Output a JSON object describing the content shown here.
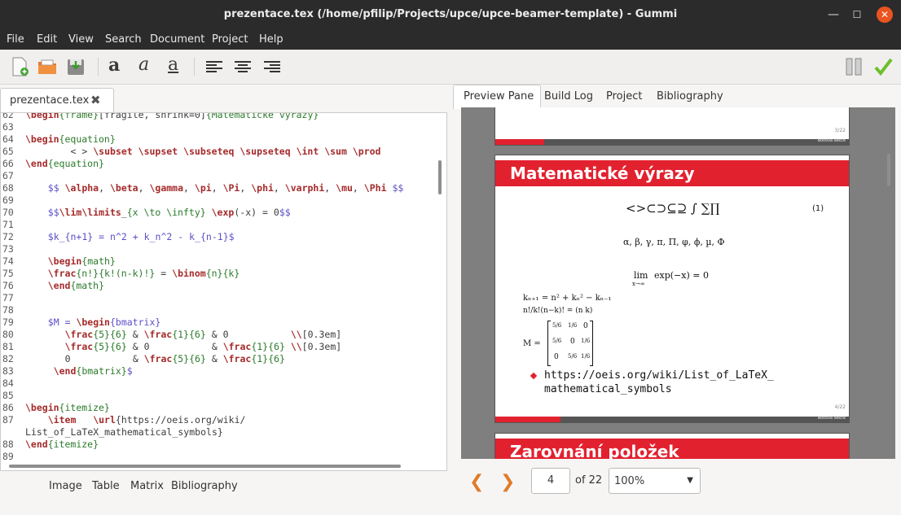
{
  "window": {
    "title": "prezentace.tex (/home/pfilip/Projects/upce/upce-beamer-template) - Gummi",
    "minimize": "—",
    "maximize": "☐",
    "close": "✕"
  },
  "menu": [
    "File",
    "Edit",
    "View",
    "Search",
    "Document",
    "Project",
    "Help"
  ],
  "toolbar": {
    "icons": [
      "new-document-icon",
      "open-folder-icon",
      "save-icon",
      "bold-icon",
      "italic-icon",
      "underline-icon",
      "align-left-icon",
      "align-center-icon",
      "align-right-icon",
      "preview-columns-icon",
      "compile-ok-icon"
    ],
    "bold_glyph": "a",
    "italic_glyph": "a",
    "underline_glyph": "a"
  },
  "editor": {
    "tab_label": "prezentace.tex",
    "tab_close": "✖",
    "lines": [
      {
        "n": "62",
        "text": "\\begin{frame}[fragile, shrink=0]{Matematické výrazy}"
      },
      {
        "n": "63",
        "text": ""
      },
      {
        "n": "64",
        "text": "\\begin{equation}"
      },
      {
        "n": "65",
        "text": "        < > \\subset \\supset \\subseteq \\supseteq \\int \\sum \\prod"
      },
      {
        "n": "66",
        "text": "\\end{equation}"
      },
      {
        "n": "67",
        "text": ""
      },
      {
        "n": "68",
        "text": "    $$ \\alpha, \\beta, \\gamma, \\pi, \\Pi, \\phi, \\varphi, \\mu, \\Phi $$"
      },
      {
        "n": "69",
        "text": ""
      },
      {
        "n": "70",
        "text": "    $$\\lim\\limits_{x \\to \\infty} \\exp(-x) = 0$$"
      },
      {
        "n": "71",
        "text": ""
      },
      {
        "n": "72",
        "text": "    $k_{n+1} = n^2 + k_n^2 - k_{n-1}$"
      },
      {
        "n": "73",
        "text": ""
      },
      {
        "n": "74",
        "text": "    \\begin{math}"
      },
      {
        "n": "75",
        "text": "    \\frac{n!}{k!(n-k)!} = \\binom{n}{k}"
      },
      {
        "n": "76",
        "text": "    \\end{math}"
      },
      {
        "n": "77",
        "text": ""
      },
      {
        "n": "78",
        "text": ""
      },
      {
        "n": "79",
        "text": "    $M = \\begin{bmatrix}"
      },
      {
        "n": "80",
        "text": "       \\frac{5}{6} & \\frac{1}{6} & 0           \\\\[0.3em]"
      },
      {
        "n": "81",
        "text": "       \\frac{5}{6} & 0           & \\frac{1}{6} \\\\[0.3em]"
      },
      {
        "n": "82",
        "text": "       0           & \\frac{5}{6} & \\frac{1}{6}"
      },
      {
        "n": "83",
        "text": "     \\end{bmatrix}$"
      },
      {
        "n": "84",
        "text": ""
      },
      {
        "n": "85",
        "text": ""
      },
      {
        "n": "86",
        "text": "\\begin{itemize}"
      },
      {
        "n": "87",
        "text": "    \\item   \\url{https://oeis.org/wiki/"
      },
      {
        "n": "",
        "text": "List_of_LaTeX_mathematical_symbols}"
      },
      {
        "n": "88",
        "text": "\\end{itemize}"
      },
      {
        "n": "89",
        "text": ""
      }
    ]
  },
  "bottom_tabs": [
    "Image",
    "Table",
    "Matrix",
    "Bibliography"
  ],
  "right_tabs": [
    "Preview Pane",
    "Build Log",
    "Project",
    "Bibliography"
  ],
  "preview": {
    "prev_slide": {
      "page": "3/22",
      "footer": "Textová sekce"
    },
    "slide": {
      "title": "Matematické výrazy",
      "eq1": "<>⊂⊃⊆⊇ ∫ ∑∏",
      "eq1_no": "(1)",
      "greek": "α, β, γ, π, Π, φ, ϕ, µ, Φ",
      "lim": "lim",
      "lim_sub": "x→∞",
      "lim_rest": "exp(−x) = 0",
      "kn": "kₙ₊₁ = n² + kₙ² − kₙ₋₁",
      "frac": "n!/k!(n−k)! = (n k)",
      "matrix_label": "M =",
      "matrix": [
        [
          "5/6",
          "1/6",
          "0"
        ],
        [
          "5/6",
          "0",
          "1/6"
        ],
        [
          "0",
          "5/6",
          "1/6"
        ]
      ],
      "bullet": "https://oeis.org/wiki/List_of_LaTeX_",
      "bullet2": "mathematical_symbols",
      "page": "4/22",
      "footer": "Textová sekce"
    },
    "next_slide": {
      "title": "Zarovnání položek"
    }
  },
  "nav": {
    "prev": "❮",
    "next": "❯",
    "page": "4",
    "of": "of 22",
    "zoom": "100%",
    "zoom_arrow": "▼"
  }
}
